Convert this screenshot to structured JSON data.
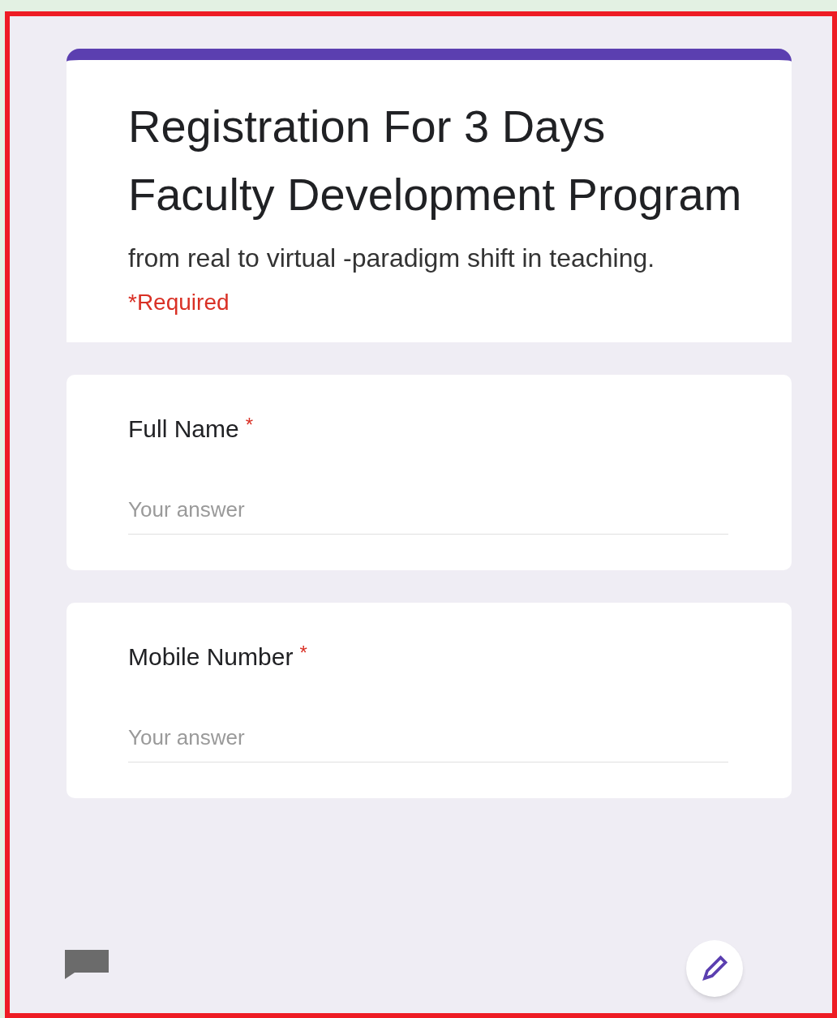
{
  "form": {
    "title": "Registration For 3 Days Faculty Development Program",
    "description": "from real to virtual -paradigm shift in teaching.",
    "required_note": "*Required"
  },
  "questions": [
    {
      "label": "Full Name",
      "required_mark": "*",
      "placeholder": "Your answer"
    },
    {
      "label": "Mobile Number",
      "required_mark": "*",
      "placeholder": "Your answer"
    }
  ]
}
